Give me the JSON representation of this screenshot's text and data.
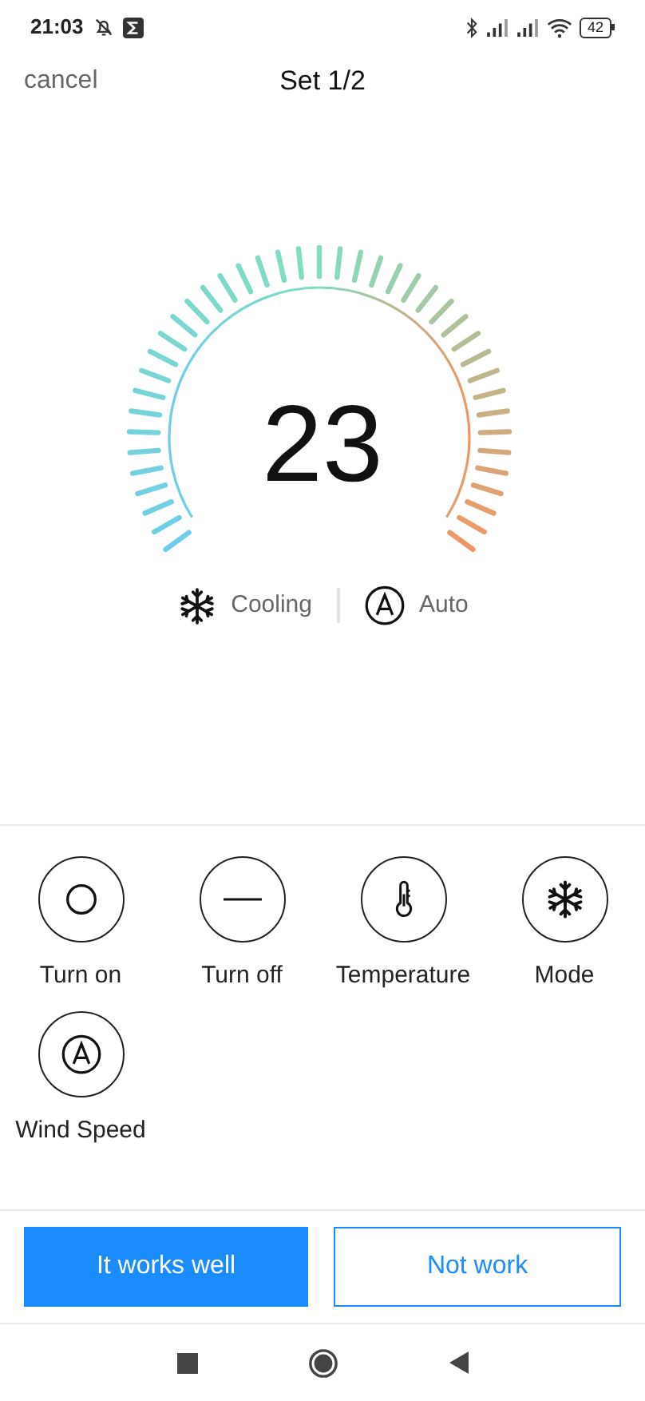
{
  "status_bar": {
    "time": "21:03",
    "battery": "42"
  },
  "header": {
    "cancel": "cancel",
    "title": "Set 1/2"
  },
  "dial": {
    "temperature": "23",
    "mode": {
      "kind": "cooling",
      "label": "Cooling"
    },
    "fan": {
      "kind": "auto",
      "label": "Auto"
    }
  },
  "controls": [
    {
      "kind": "power_on",
      "label": "Turn on"
    },
    {
      "kind": "power_off",
      "label": "Turn off"
    },
    {
      "kind": "temperature",
      "label": "Temperature"
    },
    {
      "kind": "mode",
      "label": "Mode"
    },
    {
      "kind": "wind",
      "label": "Wind Speed"
    }
  ],
  "actions": [
    {
      "label": "It works well",
      "selected": true
    },
    {
      "label": "Not work",
      "selected": false
    }
  ]
}
